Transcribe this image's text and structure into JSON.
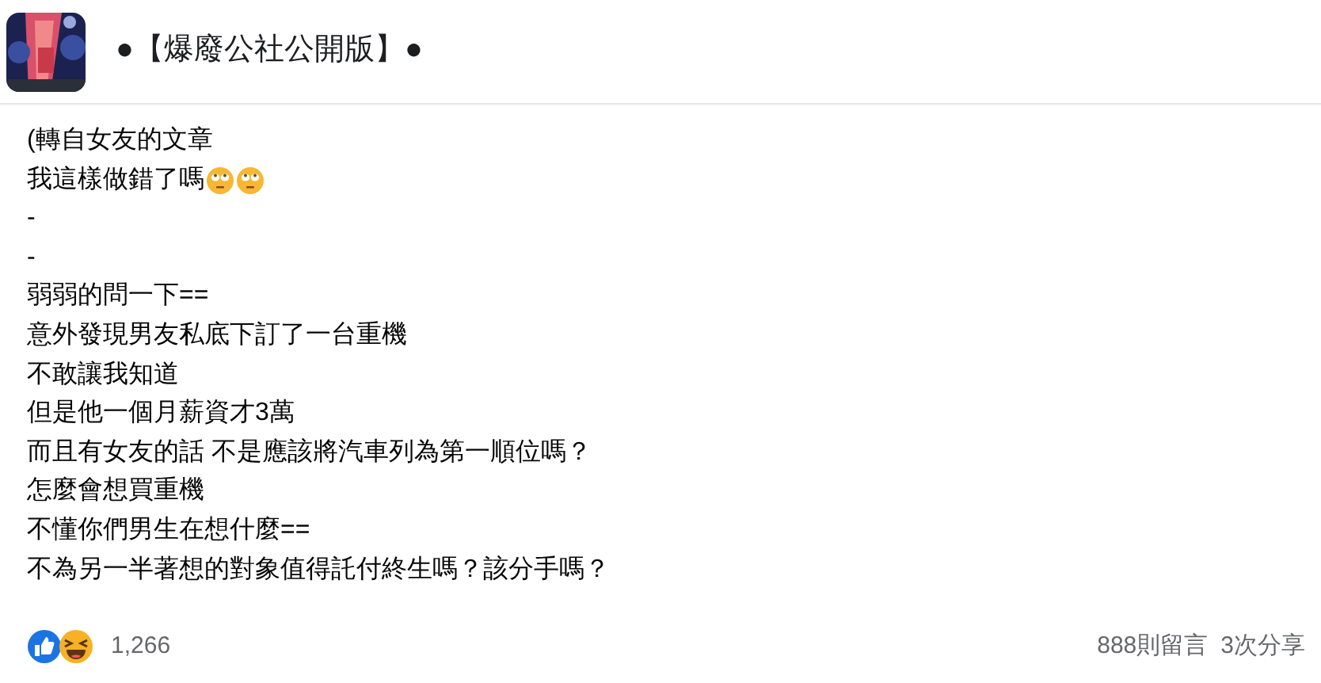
{
  "header": {
    "group_name": "●【爆廢公社公開版】●"
  },
  "post": {
    "lines": [
      {
        "text": "(轉自女友的文章"
      },
      {
        "text": "我這樣做錯了嗎",
        "emojis": [
          {
            "kind": "eye-roll"
          },
          {
            "kind": "eye-roll"
          }
        ]
      },
      {
        "text": "-"
      },
      {
        "text": "-"
      },
      {
        "text": "弱弱的問一下=="
      },
      {
        "text": "意外發現男友私底下訂了一台重機"
      },
      {
        "text": "不敢讓我知道"
      },
      {
        "text": "但是他一個月薪資才3萬"
      },
      {
        "text": "而且有女友的話 不是應該將汽車列為第一順位嗎？"
      },
      {
        "text": "怎麼會想買重機"
      },
      {
        "text": "不懂你們男生在想什麼=="
      },
      {
        "text": "不為另一半著想的對象值得託付終生嗎？該分手嗎？"
      }
    ]
  },
  "footer": {
    "reaction_count": "1,266",
    "comments": "888則留言",
    "shares": "3次分享"
  }
}
